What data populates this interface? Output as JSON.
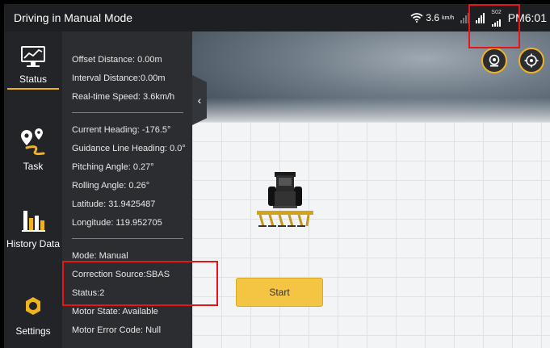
{
  "statusbar": {
    "title": "Driving in Manual Mode",
    "speed_value": "3.6",
    "speed_unit": "km/h",
    "so_label": "S02",
    "time": "PM6:01"
  },
  "nav": {
    "items": [
      {
        "label": "Status",
        "icon": "monitor-chart-icon",
        "active": true
      },
      {
        "label": "Task",
        "icon": "route-pin-icon",
        "active": false
      },
      {
        "label": "History Data",
        "icon": "bar-chart-icon",
        "active": false
      },
      {
        "label": "Settings",
        "icon": "gear-icon",
        "active": false
      }
    ]
  },
  "info": {
    "offset_distance": "Offset Distance: 0.00m",
    "interval_distance": "Interval Distance:0.00m",
    "realtime_speed": "Real-time Speed: 3.6km/h",
    "current_heading": "Current Heading: -176.5°",
    "guidance_heading": "Guidance Line Heading: 0.0°",
    "pitching_angle": "Pitching Angle: 0.27°",
    "rolling_angle": "Rolling Angle: 0.26°",
    "latitude": "Latitude: 31.9425487",
    "longitude": "Longitude: 119.952705",
    "mode": "Mode: Manual",
    "correction_source": "Correction Source:SBAS",
    "status": "Status:2",
    "motor_state": "Motor State: Available",
    "motor_error": "Motor Error Code: Null"
  },
  "scene": {
    "start_label": "Start"
  },
  "colors": {
    "accent": "#f0b320",
    "highlight": "#e8141b",
    "panel": "#2b2d31",
    "nav": "#222428"
  }
}
